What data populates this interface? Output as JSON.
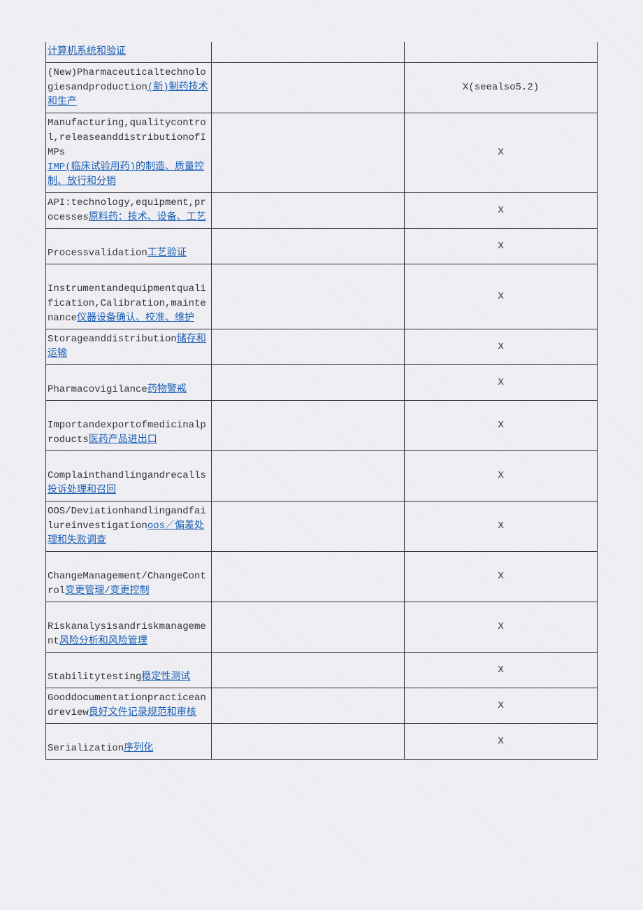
{
  "rows": [
    {
      "en": "",
      "cn": "计算机系统和验证",
      "col2": "",
      "col3": "",
      "topBorder": "none"
    },
    {
      "en": "(New)Pharmaceuticaltechnologiesandproduction",
      "cn": "(新)制药技术和生产",
      "col2": "",
      "col3": "X(seealso5.2)"
    },
    {
      "en": "Manufacturing,qualitycontrol,releaseanddistributionofIMPs\n",
      "cn": "IMP(临床试验用药)的制造、质量控制、放行和分销",
      "col2": "",
      "col3": "X"
    },
    {
      "en": "API:technology,equipment,processes",
      "cn": "原料药：技术、设备、工艺",
      "col2": "",
      "col3": "X"
    },
    {
      "en": "\nProcessvalidation",
      "cn": "工艺验证",
      "col2": "",
      "col3": "X"
    },
    {
      "en": "\nInstrumentandequipmentqualification,Calibration,maintenance",
      "cn": "仪器设备确认、校准、维护",
      "col2": "",
      "col3": "X"
    },
    {
      "en": "Storageanddistribution",
      "cn": "储存和运输",
      "col2": "",
      "col3": "X"
    },
    {
      "en": "\nPharmacovigilance",
      "cn": "药物警戒",
      "col2": "",
      "col3": "X"
    },
    {
      "en": "\nImportandexportofmedicinalproducts",
      "cn": "医药产品进出口",
      "col2": "",
      "col3": "X"
    },
    {
      "en": "\nComplainthandlingandrecalls",
      "cn": "投诉处理和召回",
      "col2": "",
      "col3": "X"
    },
    {
      "en": "OOS/Deviationhandlingandfailureinvestigation",
      "cn": "oos／偏差处理和失败调查",
      "col2": "",
      "col3": "X"
    },
    {
      "en": "\nChangeManagement/ChangeControl",
      "cn": "变更管理/变更控制",
      "col2": "",
      "col3": "X"
    },
    {
      "en": "\nRiskanalysisandriskmanagement",
      "cn": "风险分析和风险管理",
      "col2": "",
      "col3": "X"
    },
    {
      "en": "\nStabilitytesting",
      "cn": "稳定性测试",
      "col2": "",
      "col3": "X"
    },
    {
      "en": "Gooddocumentationpracticeandreview",
      "cn": "良好文件记录规范和审核",
      "col2": "",
      "col3": "X"
    },
    {
      "en": "\nSerialization",
      "cn": "序列化",
      "col2": "",
      "col3": "X"
    }
  ]
}
